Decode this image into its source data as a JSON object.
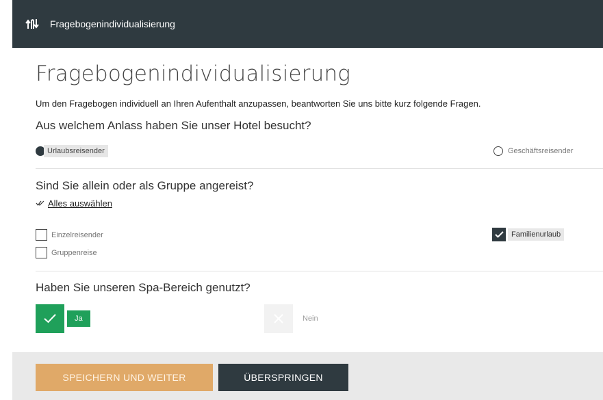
{
  "topbar": {
    "title": "Fragebogenindividualisierung",
    "icon": "swap-arrows-icon"
  },
  "page": {
    "heading": "Fragebogenindividualisierung",
    "intro": "Um den Fragebogen individuell an Ihren Aufenthalt anzupassen, beantworten Sie uns bitte kurz folgende Fragen."
  },
  "q1": {
    "question": "Aus welchem Anlass haben Sie unser Hotel besucht?",
    "options": [
      {
        "label": "Urlaubsreisender",
        "selected": true
      },
      {
        "label": "Geschäftsreisender",
        "selected": false
      }
    ]
  },
  "q2": {
    "question": "Sind Sie allein oder als Gruppe angereist?",
    "select_all": "Alles auswählen",
    "options": [
      {
        "label": "Einzelreisender",
        "checked": false
      },
      {
        "label": "Gruppenreise",
        "checked": false
      },
      {
        "label": "Familienurlaub",
        "checked": true
      }
    ]
  },
  "q3": {
    "question": "Haben Sie unseren Spa-Bereich genutzt?",
    "yes": "Ja",
    "no": "Nein",
    "answer": "Ja"
  },
  "footer": {
    "save_label": "SPEICHERN UND WEITER",
    "skip_label": "ÜBERSPRINGEN"
  },
  "colors": {
    "topbar": "#2f3a40",
    "accent_green": "#1fa05a",
    "save_button": "#e0a968",
    "skip_button": "#2f3a40"
  }
}
